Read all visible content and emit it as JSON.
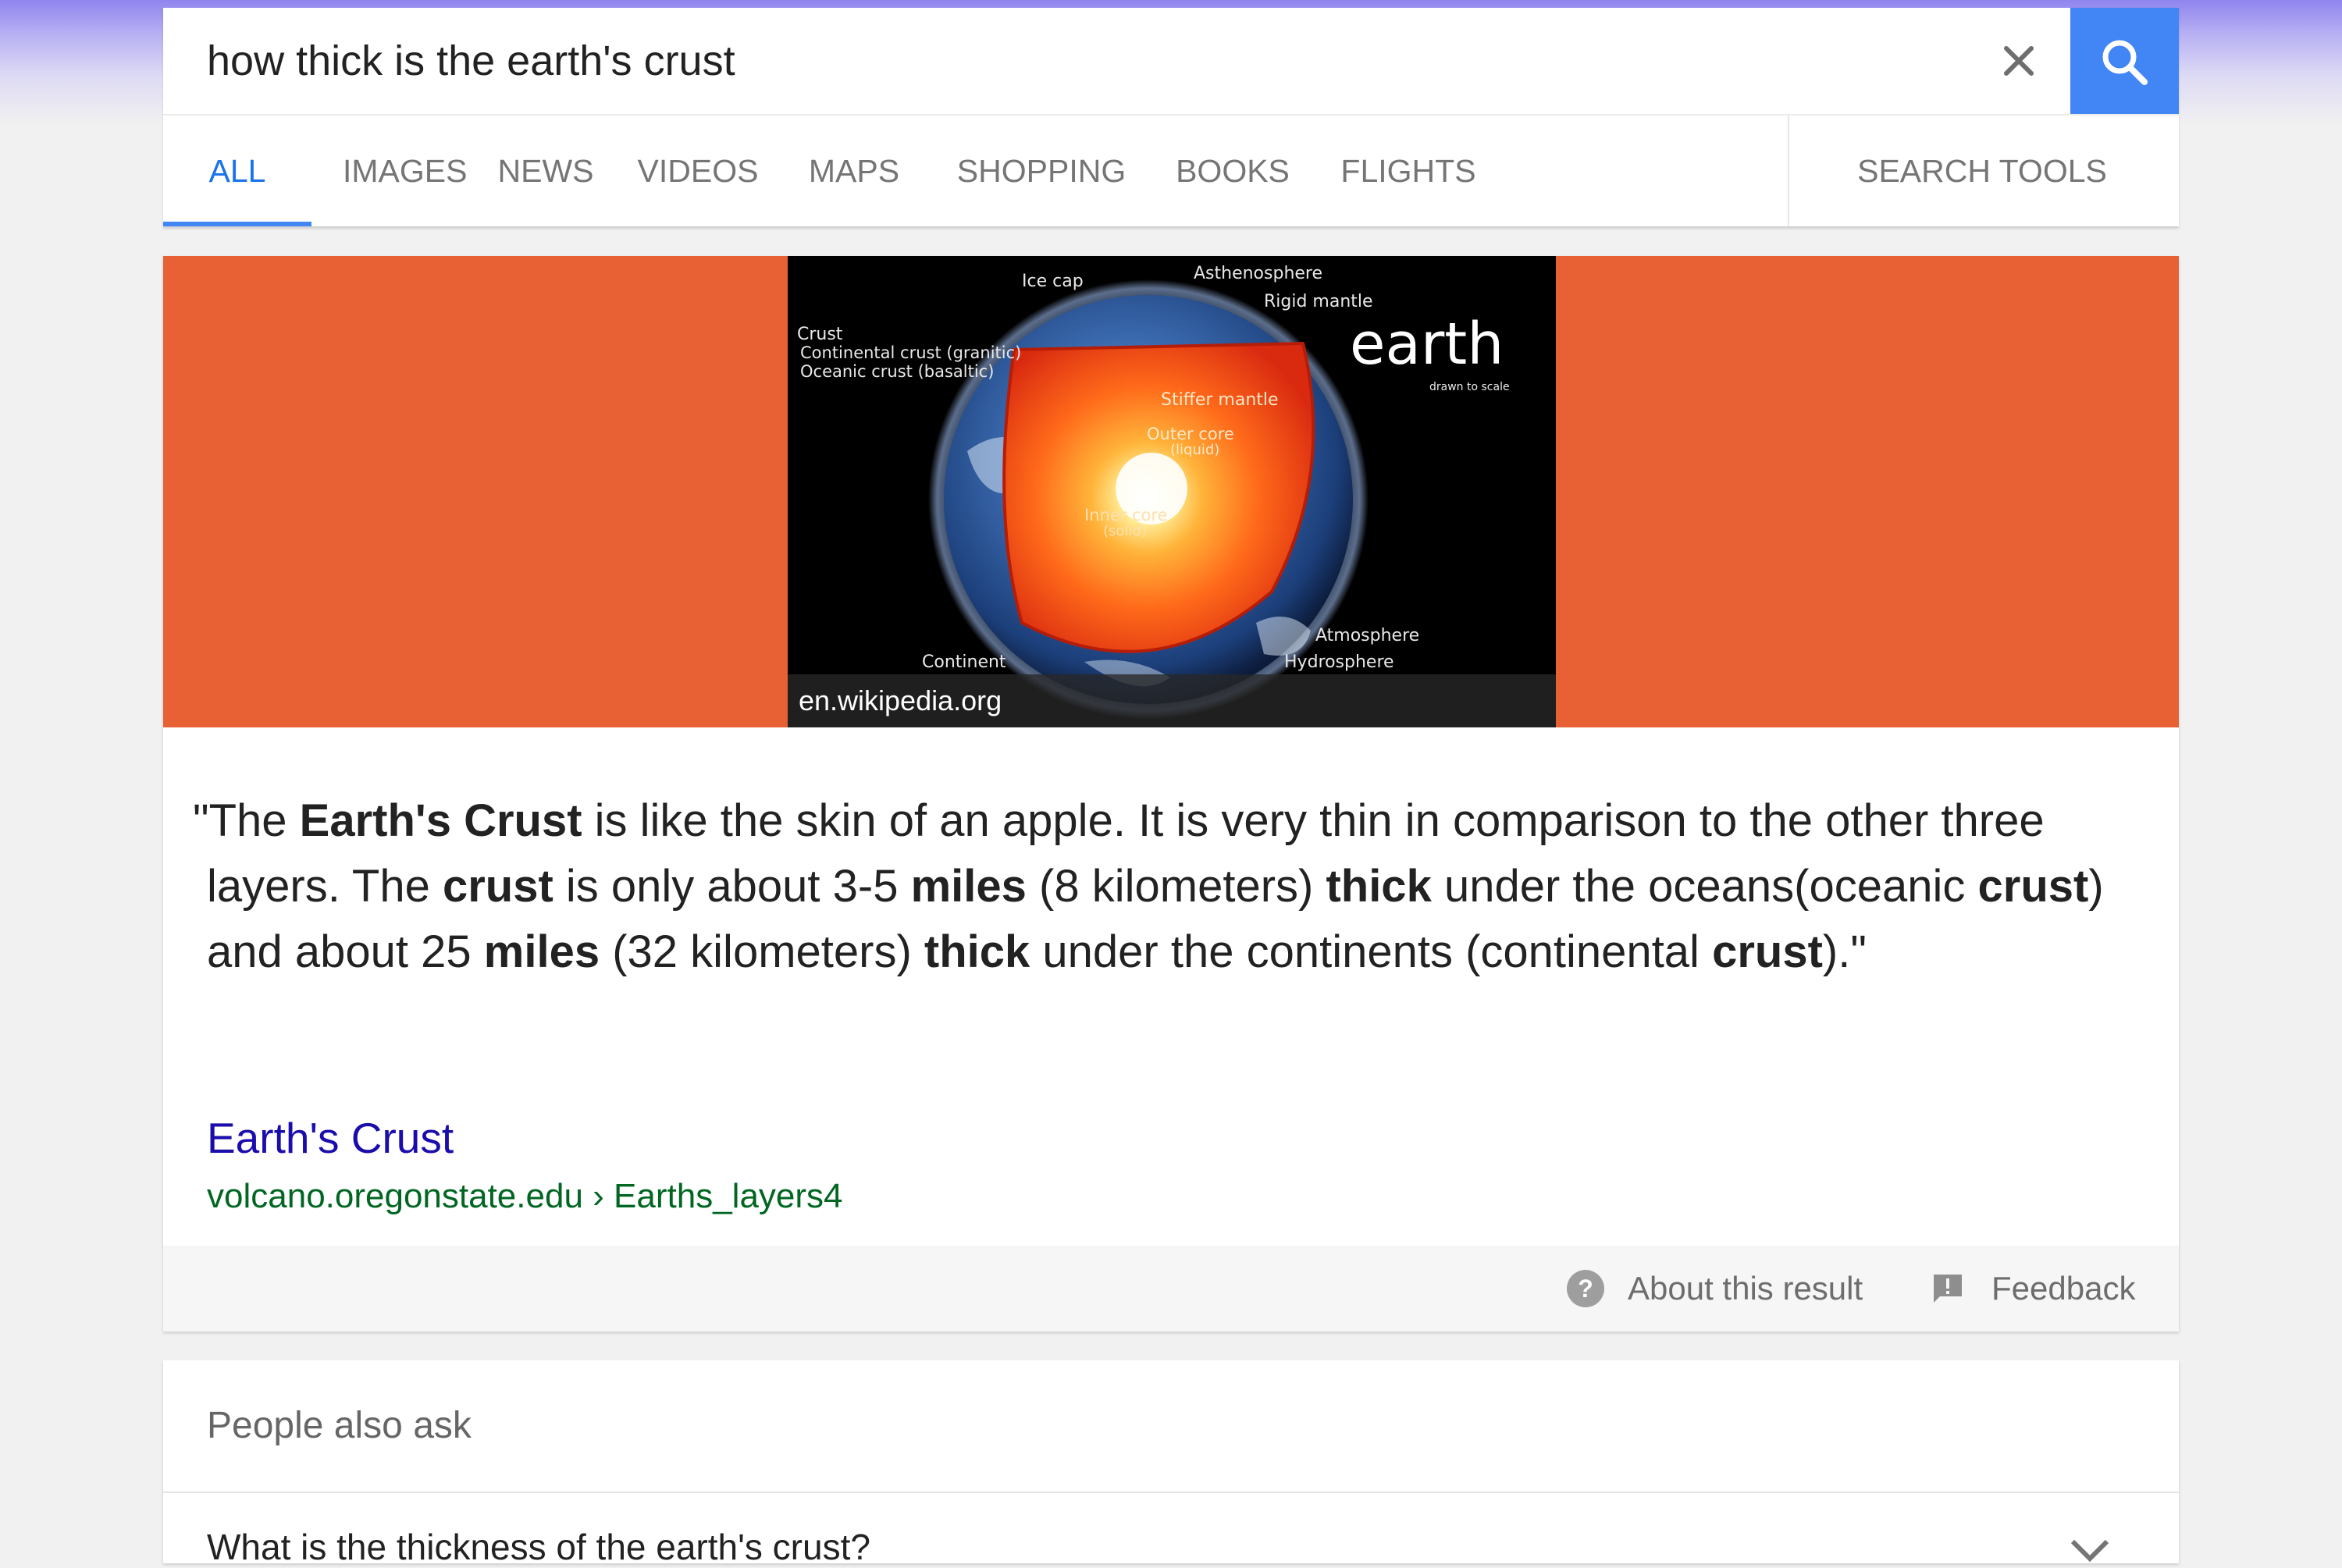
{
  "search": {
    "query": "how thick is the earth's crust"
  },
  "tabs": [
    "ALL",
    "IMAGES",
    "NEWS",
    "VIDEOS",
    "MAPS",
    "SHOPPING",
    "BOOKS",
    "FLIGHTS"
  ],
  "search_tools_label": "SEARCH TOOLS",
  "active_tab": "ALL",
  "banner": {
    "color": "#e86134",
    "image_source": "en.wikipedia.org",
    "image_labels": {
      "ice_cap": "Ice cap",
      "asthenosphere": "Asthenosphere",
      "rigid_mantle": "Rigid mantle",
      "crust": "Crust",
      "continental_crust": "Continental crust (granitic)",
      "oceanic_crust": "Oceanic crust (basaltic)",
      "earth": "earth",
      "drawn_to_scale": "drawn to scale",
      "stiffer_mantle": "Stiffer mantle",
      "outer_core": "Outer core",
      "outer_core_state": "(liquid)",
      "inner_core": "Inner core",
      "inner_core_state": "(solid)",
      "atmosphere": "Atmosphere",
      "hydrosphere": "Hydrosphere",
      "continent": "Continent"
    }
  },
  "snippet": {
    "open_quote": "\"The ",
    "t1": "Earth's Crust",
    "t2": " is like the skin of an apple. It is very thin in comparison to the other three layers. The ",
    "t3": "crust",
    "t4": " is only about 3-5 ",
    "t5": "miles",
    "t6": " (8 kilometers) ",
    "t7": "thick",
    "t8": " under the oceans(oceanic ",
    "t9": "crust",
    "t10": ") and about 25 ",
    "t11": "miles",
    "t12": " (32 kilometers) ",
    "t13": "thick",
    "t14": " under the continents (continental ",
    "t15": "crust",
    "t16": ").\""
  },
  "result": {
    "title": "Earth's Crust",
    "domain": "volcano.oregonstate.edu",
    "separator": " › ",
    "path": "Earths_layers4"
  },
  "footer": {
    "about_label": "About this result",
    "feedback_label": "Feedback"
  },
  "people_also_ask": {
    "title": "People also ask",
    "questions": [
      "What is the thickness of the earth's crust?"
    ]
  },
  "colors": {
    "accent": "#4285f4",
    "link": "#1a0dab",
    "url": "#006621"
  }
}
